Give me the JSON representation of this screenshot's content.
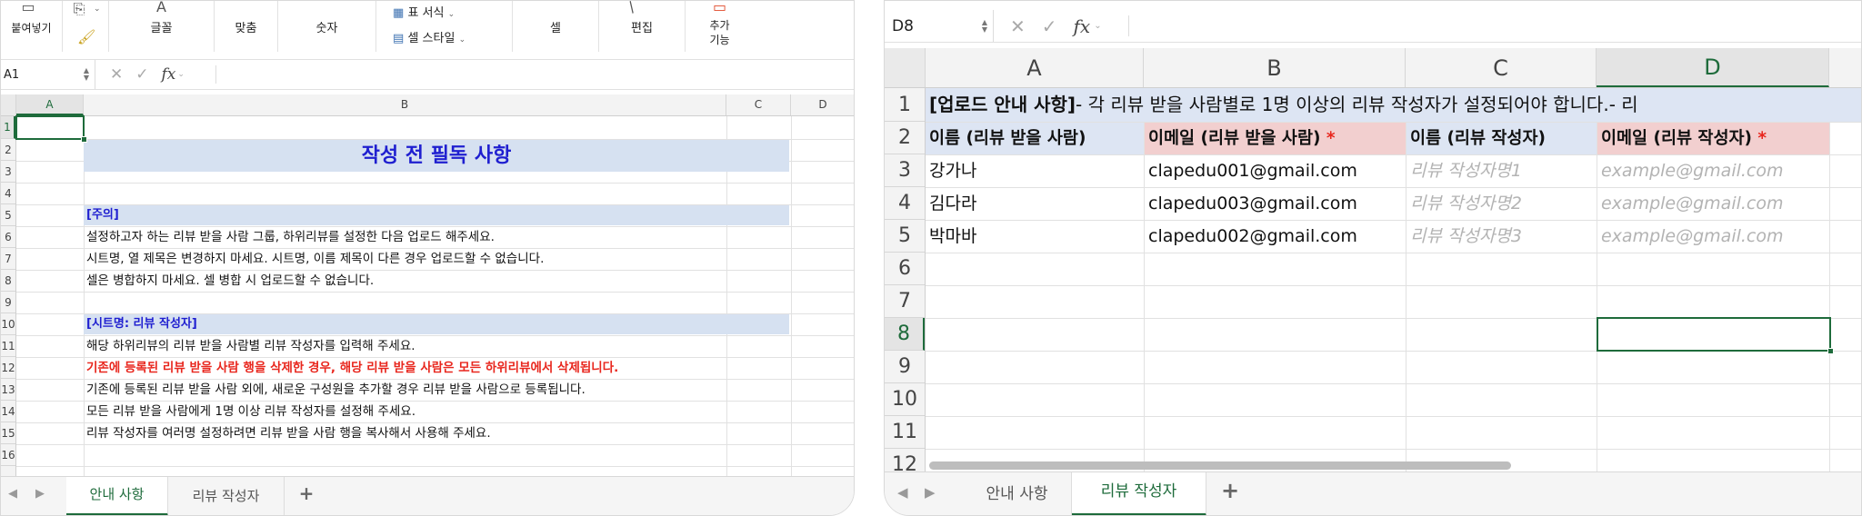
{
  "left": {
    "ribbon": {
      "paste": "붙여넣기",
      "font": "글꼴",
      "align": "맞춤",
      "number": "숫자",
      "format_table": "표 서식",
      "cell_styles": "셀 스타일",
      "cells": "셀",
      "editing": "편집",
      "addins_1": "추가",
      "addins_2": "기능"
    },
    "name_box": "A1",
    "fx": "fx",
    "columns": [
      "A",
      "B",
      "C",
      "D"
    ],
    "rows": [
      "1",
      "2",
      "3",
      "4",
      "5",
      "6",
      "7",
      "8",
      "9",
      "10",
      "11",
      "12",
      "13",
      "14",
      "15",
      "16"
    ],
    "title": "작성 전 필독 사항",
    "section1_heading": "[주의]",
    "s1_line1": "설정하고자 하는 리뷰 받을 사람 그룹, 하위리뷰를 설정한 다음 업로드 해주세요.",
    "s1_line2": "시트명, 열 제목은 변경하지 마세요. 시트명, 이름 제목이 다른 경우 업로드할 수 없습니다.",
    "s1_line3": "셀은 병합하지 마세요. 셀 병합 시 업로드할 수 없습니다.",
    "section2_heading": "[시트명: 리뷰 작성자]",
    "s2_line1": "해당 하위리뷰의 리뷰 받을 사람별 리뷰 작성자를 입력해 주세요.",
    "s2_line2_warning": "기존에 등록된 리뷰 받을 사람 행을 삭제한 경우, 해당 리뷰 받을 사람은 모든 하위리뷰에서 삭제됩니다.",
    "s2_line3": "기존에 등록된 리뷰 받을 사람 외에, 새로운 구성원을 추가할 경우 리뷰 받을 사람으로 등록됩니다.",
    "s2_line4": "모든 리뷰 받을 사람에게 1명 이상 리뷰 작성자를 설정해 주세요.",
    "s2_line5": "리뷰 작성자를 여러명 설정하려면 리뷰 받을 사람 행을 복사해서 사용해 주세요.",
    "tabs": [
      "안내 사항",
      "리뷰 작성자"
    ],
    "add_sheet": "+"
  },
  "right": {
    "name_box": "D8",
    "fx": "fx",
    "columns": [
      "A",
      "B",
      "C",
      "D"
    ],
    "rows": [
      "1",
      "2",
      "3",
      "4",
      "5",
      "6",
      "7",
      "8",
      "9",
      "10",
      "11",
      "12"
    ],
    "row1_label": "[업로드 안내 사항]",
    "row1_text": "- 각 리뷰 받을 사람별로 1명 이상의 리뷰 작성자가 설정되어야 합니다.- 리",
    "headers": {
      "a": "이름 (리뷰 받을 사람)",
      "b": "이메일 (리뷰 받을 사람)",
      "c": "이름 (리뷰 작성자)",
      "d": "이메일 (리뷰 작성자)"
    },
    "required_mark": "*",
    "data_rows": [
      {
        "name": "강가나",
        "email": "clapedu001@gmail.com",
        "reviewer": "리뷰 작성자명1",
        "reviewer_email": "example@gmail.com"
      },
      {
        "name": "김다라",
        "email": "clapedu003@gmail.com",
        "reviewer": "리뷰 작성자명2",
        "reviewer_email": "example@gmail.com"
      },
      {
        "name": "박마바",
        "email": "clapedu002@gmail.com",
        "reviewer": "리뷰 작성자명3",
        "reviewer_email": "example@gmail.com"
      }
    ],
    "tabs": [
      "안내 사항",
      "리뷰 작성자"
    ],
    "add_sheet": "+"
  },
  "colors": {
    "accent_green": "#1e6b3b",
    "title_blue": "#1f1fd0",
    "band_blue": "#d6e1f1",
    "header_pink": "#f2cfcf",
    "warning_red": "#e8261d",
    "placeholder_gray": "#b3b3b3"
  }
}
